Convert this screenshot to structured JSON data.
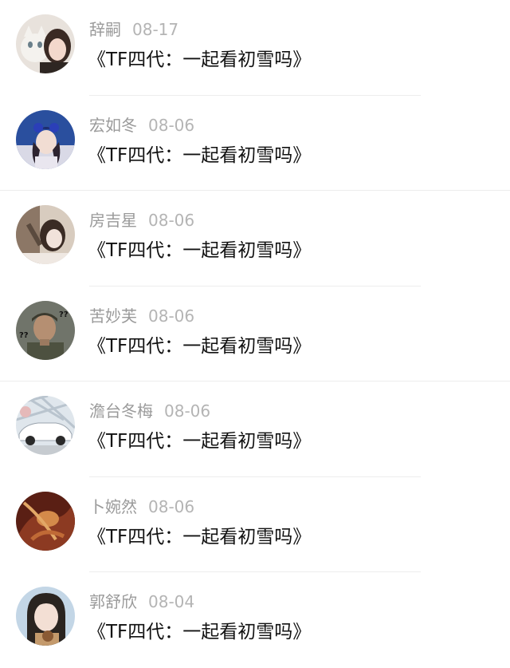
{
  "comments": [
    {
      "author": "辞嗣",
      "date": "08-17",
      "text": "《TF四代：一起看初雪吗》",
      "avatar_icon": "avatar-cat-girl-icon",
      "avatar_colors": [
        "#d9d2cc",
        "#4a3b36"
      ]
    },
    {
      "author": "宏如冬",
      "date": "08-06",
      "text": "《TF四代：一起看初雪吗》",
      "avatar_icon": "avatar-blue-hat-girl-icon",
      "avatar_colors": [
        "#244a9a",
        "#e7d6cf"
      ]
    },
    {
      "author": "房吉星",
      "date": "08-06",
      "text": "《TF四代：一起看初雪吗》",
      "avatar_icon": "avatar-girl-photo-icon",
      "avatar_colors": [
        "#c9b9a8",
        "#3a2c26"
      ]
    },
    {
      "author": "苦妙芙",
      "date": "08-06",
      "text": "《TF四代：一起看初雪吗》",
      "avatar_icon": "avatar-man-meme-icon",
      "avatar_colors": [
        "#6d7166",
        "#2f302a"
      ]
    },
    {
      "author": "澹台冬梅",
      "date": "08-06",
      "text": "《TF四代：一起看初雪吗》",
      "avatar_icon": "avatar-white-car-icon",
      "avatar_colors": [
        "#cfd8e0",
        "#ffffff"
      ]
    },
    {
      "author": "卜婉然",
      "date": "08-06",
      "text": "《TF四代：一起看初雪吗》",
      "avatar_icon": "avatar-dark-red-art-icon",
      "avatar_colors": [
        "#7a2d1c",
        "#d88a4c"
      ]
    },
    {
      "author": "郭舒欣",
      "date": "08-04",
      "text": "《TF四代：一起看初雪吗》",
      "avatar_icon": "avatar-girl-selfie-icon",
      "avatar_colors": [
        "#bcd2e5",
        "#2a2624"
      ]
    }
  ]
}
